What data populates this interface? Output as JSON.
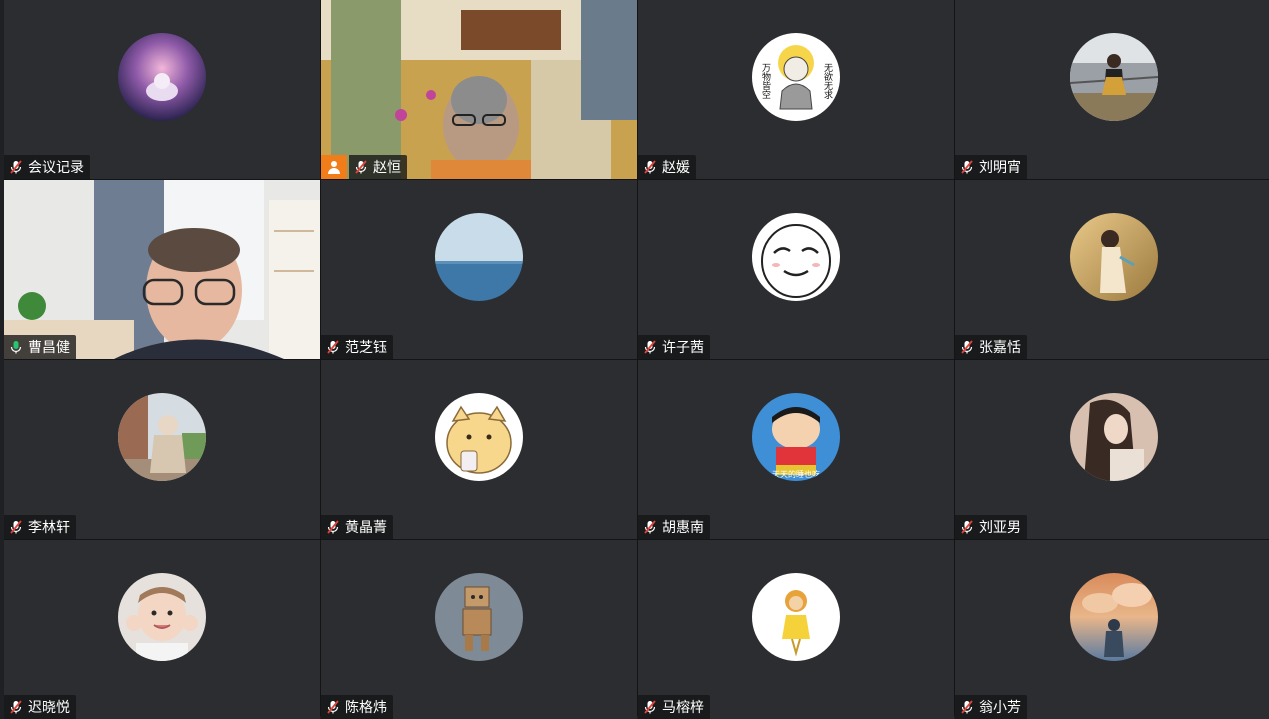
{
  "participants": [
    {
      "name": "会议记录",
      "mic": "muted"
    },
    {
      "name": "赵恒",
      "mic": "muted",
      "video": true,
      "host_badge": true
    },
    {
      "name": "赵媛",
      "mic": "muted",
      "avatar_text_left": "万物皆空",
      "avatar_text_right": "无欲无求"
    },
    {
      "name": "刘明宵",
      "mic": "muted"
    },
    {
      "name": "曹昌健",
      "mic": "active",
      "video": true,
      "speaking": true
    },
    {
      "name": "范芝钰",
      "mic": "muted"
    },
    {
      "name": "许子茜",
      "mic": "muted"
    },
    {
      "name": "张嘉恬",
      "mic": "muted"
    },
    {
      "name": "李林轩",
      "mic": "muted"
    },
    {
      "name": "黄晶菁",
      "mic": "muted"
    },
    {
      "name": "胡惠南",
      "mic": "muted",
      "avatar_caption": "天天的睡也吃"
    },
    {
      "name": "刘亚男",
      "mic": "muted"
    },
    {
      "name": "迟晓悦",
      "mic": "muted"
    },
    {
      "name": "陈格炜",
      "mic": "muted"
    },
    {
      "name": "马榕梓",
      "mic": "muted"
    },
    {
      "name": "翁小芳",
      "mic": "muted"
    }
  ],
  "colors": {
    "speaking_border": "#27c66e",
    "mic_muted": "#e0433c",
    "mic_active": "#27c66e",
    "host_badge": "#f07d1a"
  }
}
